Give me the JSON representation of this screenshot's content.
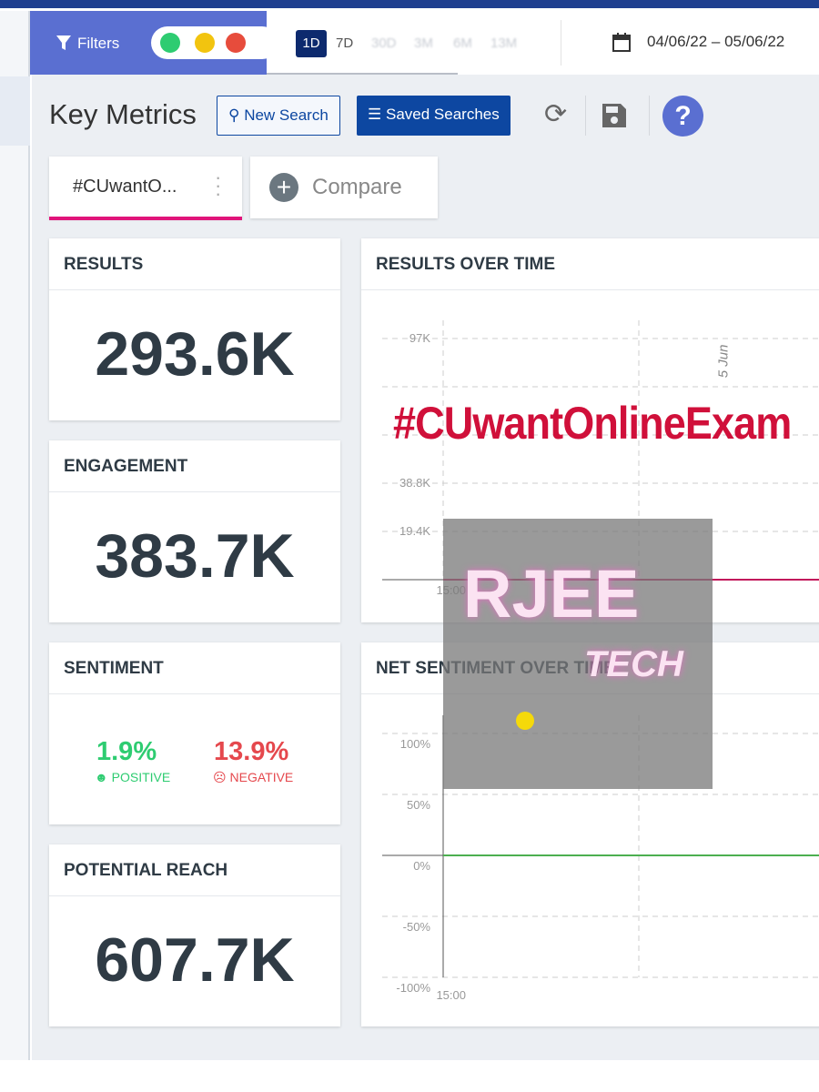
{
  "header": {
    "filters_label": "Filters",
    "ranges": [
      "1D",
      "7D",
      "30D",
      "3M",
      "6M",
      "13M"
    ],
    "active_range": "1D",
    "date_range": "04/06/22 – 05/06/22"
  },
  "toolbar": {
    "title": "Key Metrics",
    "new_search": "New Search",
    "saved_searches": "Saved Searches"
  },
  "tabs": {
    "query": "#CUwantO...",
    "compare": "Compare"
  },
  "metrics": {
    "results": {
      "label": "RESULTS",
      "value": "293.6K"
    },
    "engagement": {
      "label": "ENGAGEMENT",
      "value": "383.7K"
    },
    "sentiment": {
      "label": "SENTIMENT",
      "positive": "1.9%",
      "positive_label": "POSITIVE",
      "negative": "13.9%",
      "negative_label": "NEGATIVE"
    },
    "reach": {
      "label": "POTENTIAL REACH",
      "value": "607.7K"
    }
  },
  "colors": {
    "accent": "#e0147a",
    "positive": "#2ecc71",
    "negative": "#e5484d",
    "primary": "#0d47a1"
  },
  "chart_data": [
    {
      "type": "line",
      "title": "RESULTS OVER TIME",
      "yticks": [
        "97K",
        "38.8K",
        "19.4K"
      ],
      "xticks": [
        "15:00"
      ],
      "annotation": "5 Jun",
      "ylim": [
        0,
        97000
      ],
      "series": [
        {
          "values": [
            0,
            0
          ]
        }
      ],
      "color": "#c2185b"
    },
    {
      "type": "line",
      "title": "NET SENTIMENT OVER TIME",
      "yticks": [
        "100%",
        "50%",
        "0%",
        "-50%",
        "-100%"
      ],
      "xticks": [
        "15:00"
      ],
      "ylim": [
        -100,
        100
      ],
      "series": [
        {
          "values": [
            0,
            0
          ]
        }
      ],
      "color": "#4caf50"
    }
  ],
  "watermark": {
    "hashtag": "#CUwantOnlineExam",
    "logo_line1": "RJEE",
    "logo_line2": "TECH"
  }
}
